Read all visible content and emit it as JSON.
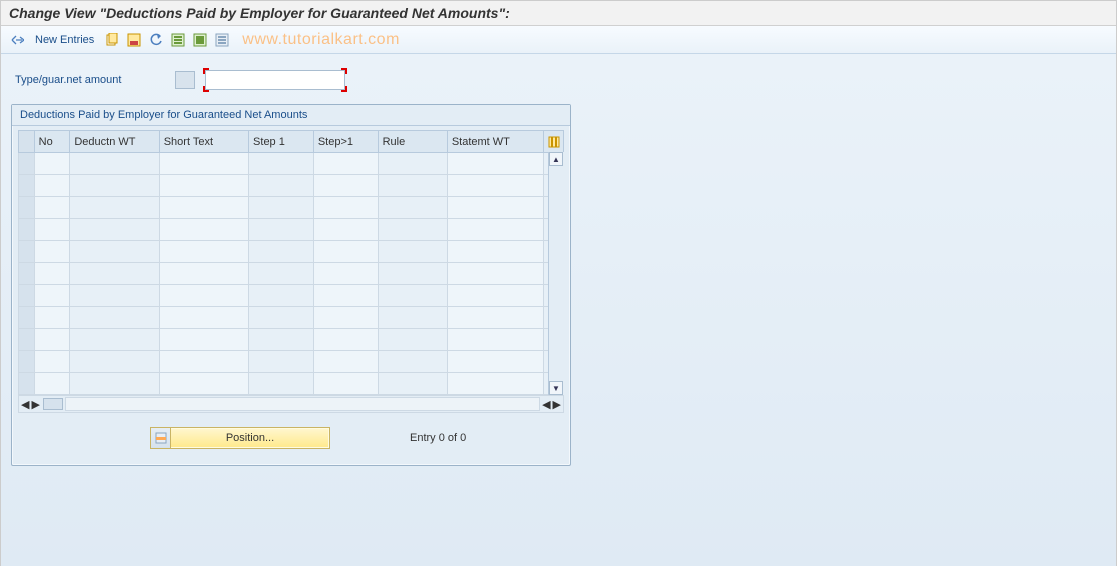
{
  "header": {
    "title": "Change View \"Deductions Paid by Employer for Guaranteed Net Amounts\":"
  },
  "toolbar": {
    "new_entries": "New Entries"
  },
  "watermark": "www.tutorialkart.com",
  "field": {
    "label": "Type/guar.net amount",
    "value": ""
  },
  "panel": {
    "title": "Deductions Paid by Employer for Guaranteed Net Amounts",
    "columns": [
      "No",
      "Deductn WT",
      "Short Text",
      "Step 1",
      "Step>1",
      "Rule",
      "Statemt WT"
    ],
    "row_count": 11
  },
  "footer": {
    "position_label": "Position...",
    "entry_text": "Entry 0 of 0"
  }
}
